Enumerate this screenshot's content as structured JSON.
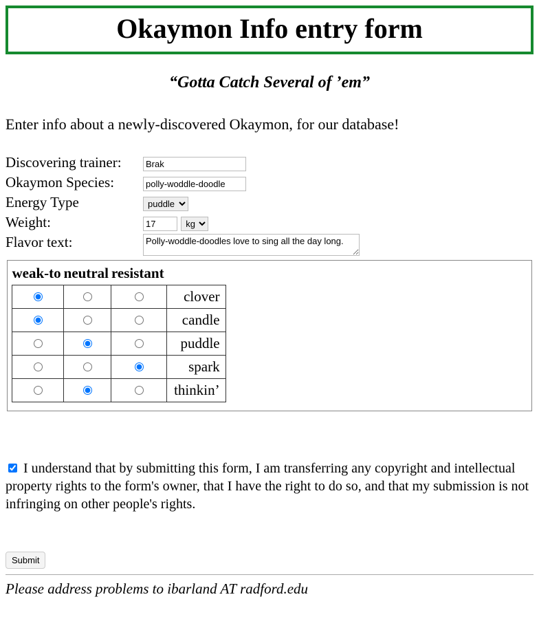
{
  "title": "Okaymon Info entry form",
  "tagline": "“Gotta Catch Several of ’em”",
  "intro": "Enter info about a newly-discovered Okaymon, for our database!",
  "labels": {
    "trainer": "Discovering trainer:",
    "species": "Okaymon Species:",
    "energy": "Energy Type",
    "weight": "Weight:",
    "flavor": "Flavor text:"
  },
  "values": {
    "trainer": "Brak",
    "species": "polly-woddle-doodle",
    "energy_selected": "puddle",
    "weight": "17",
    "weight_unit_selected": "kg",
    "flavor": "Polly-woddle-doodles love to sing all the day long."
  },
  "matrix": {
    "headers": [
      "weak-to",
      "neutral",
      "resistant"
    ],
    "rows": [
      {
        "name": "clover",
        "selected": 0
      },
      {
        "name": "candle",
        "selected": 0
      },
      {
        "name": "puddle",
        "selected": 1
      },
      {
        "name": "spark",
        "selected": 2
      },
      {
        "name": "thinkin’",
        "selected": 1
      }
    ]
  },
  "consent": {
    "checked": true,
    "text": "I understand that by submitting this form, I am transferring any copyright and intellectual property rights to the form's owner, that I have the right to do so, and that my submission is not infringing on other people's rights."
  },
  "submit_label": "Submit",
  "footer": "Please address problems to ibarland  AT radford.edu"
}
